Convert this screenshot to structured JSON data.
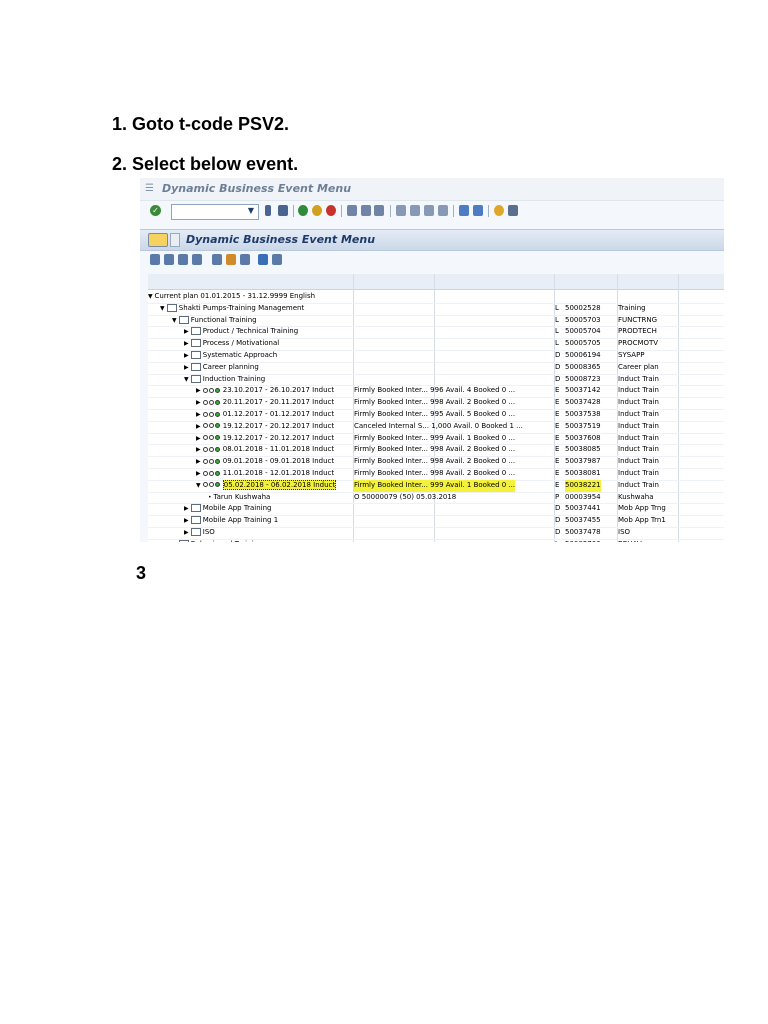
{
  "steps": {
    "step1": "1. Goto t-code PSV2.",
    "step2": "2. Select below event.",
    "step3": "3"
  },
  "screenshot": {
    "window_title": "Dynamic Business Event Menu",
    "panel_title": "Dynamic Business Event Menu",
    "rows": [
      {
        "indent": 1,
        "icon": "triangle-down",
        "label": "Current plan 01.01.2015 - 31.12.9999 English",
        "info": "",
        "type": "",
        "id": "",
        "short": ""
      },
      {
        "indent": 2,
        "icon": "folder",
        "label": "Shakti Pumps-Training Management",
        "info": "",
        "type": "L",
        "id": "50002528",
        "short": "Training"
      },
      {
        "indent": 3,
        "icon": "folder",
        "label": "Functional Training",
        "info": "",
        "type": "L",
        "id": "50005703",
        "short": "FUNCTRNG"
      },
      {
        "indent": 4,
        "icon": "folder",
        "label": "Product / Technical Training",
        "info": "",
        "type": "L",
        "id": "50005704",
        "short": "PRODTECH"
      },
      {
        "indent": 4,
        "icon": "folder",
        "label": "Process / Motivational",
        "info": "",
        "type": "L",
        "id": "50005705",
        "short": "PROCMOTV"
      },
      {
        "indent": 4,
        "icon": "doc",
        "label": "Systematic Approach",
        "info": "",
        "type": "D",
        "id": "50006194",
        "short": "SYSAPP"
      },
      {
        "indent": 4,
        "icon": "doc",
        "label": "Career planning",
        "info": "",
        "type": "D",
        "id": "50008365",
        "short": "Career plan"
      },
      {
        "indent": 4,
        "icon": "doc",
        "label": "Induction Training",
        "info": "",
        "type": "D",
        "id": "50008723",
        "short": "Induct Train"
      },
      {
        "indent": 5,
        "icon": "lights",
        "label": "23.10.2017 - 26.10.2017 Induct",
        "info": "Firmly Booked Inter...  996  Avail.   4 Booked     0 ...",
        "type": "E",
        "id": "50037142",
        "short": "Induct Train"
      },
      {
        "indent": 5,
        "icon": "lights",
        "label": "20.11.2017 - 20.11.2017 Induct",
        "info": "Firmly Booked Inter...  998  Avail.   2 Booked     0 ...",
        "type": "E",
        "id": "50037428",
        "short": "Induct Train"
      },
      {
        "indent": 5,
        "icon": "lights",
        "label": "01.12.2017 - 01.12.2017 Induct",
        "info": "Firmly Booked Inter...  995  Avail.   5 Booked     0 ...",
        "type": "E",
        "id": "50037538",
        "short": "Induct Train"
      },
      {
        "indent": 5,
        "icon": "lights",
        "label": "19.12.2017 - 20.12.2017 Induct",
        "info": "Canceled Internal S...  1,000 Avail.   0 Booked     1 ...",
        "type": "E",
        "id": "50037519",
        "short": "Induct Train"
      },
      {
        "indent": 5,
        "icon": "lights",
        "label": "19.12.2017 - 20.12.2017 Induct",
        "info": "Firmly Booked Inter...  999  Avail.   1 Booked     0 ...",
        "type": "E",
        "id": "50037608",
        "short": "Induct Train"
      },
      {
        "indent": 5,
        "icon": "lights",
        "label": "08.01.2018 - 11.01.2018 Induct",
        "info": "Firmly Booked Inter...  998  Avail.   2 Booked     0 ...",
        "type": "E",
        "id": "50038085",
        "short": "Induct Train"
      },
      {
        "indent": 5,
        "icon": "lights",
        "label": "09.01.2018 - 09.01.2018 Induct",
        "info": "Firmly Booked Inter...  998  Avail.   2 Booked     0 ...",
        "type": "E",
        "id": "50037987",
        "short": "Induct Train"
      },
      {
        "indent": 5,
        "icon": "lights",
        "label": "11.01.2018 - 12.01.2018 Induct",
        "info": "Firmly Booked Inter...  998  Avail.   2 Booked     0 ...",
        "type": "E",
        "id": "50038081",
        "short": "Induct Train"
      },
      {
        "indent": 5,
        "icon": "lights",
        "label": "05.02.2018 - 06.02.2018 Induct",
        "info": "Firmly Booked Inter...  999  Avail.   1 Booked     0 ...",
        "type": "E",
        "id": "50038221",
        "short": "Induct Train",
        "highlight": true
      },
      {
        "indent": 6,
        "icon": "dot",
        "label": "Tarun Kushwaha",
        "info": "O  50000079          (50) 05.03.2018",
        "type": "P",
        "id": "00003954",
        "short": "Kushwaha"
      },
      {
        "indent": 4,
        "icon": "doc",
        "label": "Mobile App Training",
        "info": "",
        "type": "D",
        "id": "50037441",
        "short": "Mob App Trng"
      },
      {
        "indent": 4,
        "icon": "doc",
        "label": "Mobile App Training 1",
        "info": "",
        "type": "D",
        "id": "50037455",
        "short": "Mob App Trn1"
      },
      {
        "indent": 4,
        "icon": "doc",
        "label": "ISO",
        "info": "",
        "type": "D",
        "id": "50037478",
        "short": "ISO"
      },
      {
        "indent": 3,
        "icon": "folder",
        "label": "Behavioural Training",
        "info": "",
        "type": "L",
        "id": "50005706",
        "short": "BEHAV"
      }
    ]
  }
}
